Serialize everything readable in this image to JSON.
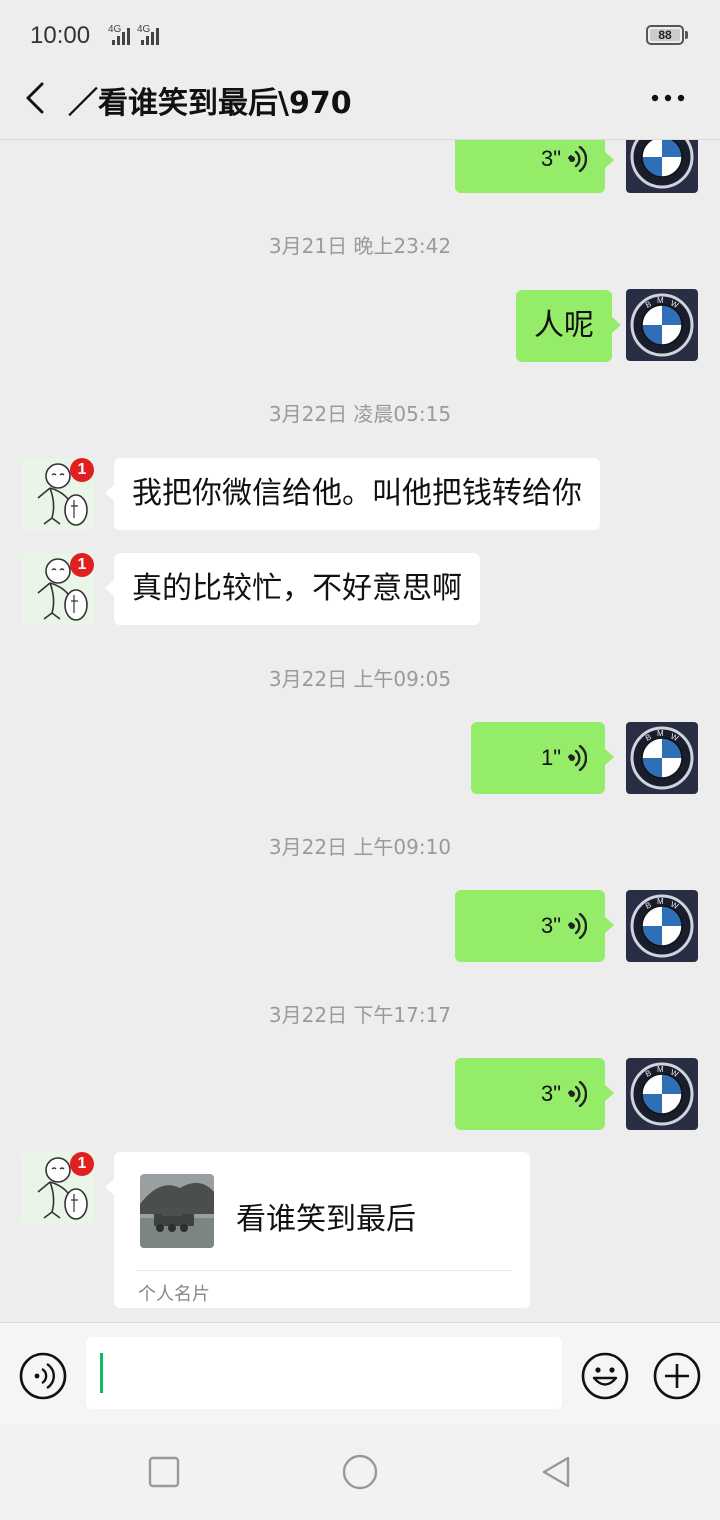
{
  "status": {
    "time": "10:00",
    "net1": "4G",
    "net2": "4G",
    "battery": "88"
  },
  "header": {
    "title": "／看谁笑到最后\\970"
  },
  "contact": {
    "unread_badge": "1"
  },
  "messages": [
    {
      "side": "right",
      "type": "voice",
      "duration": "3\""
    },
    {
      "type": "timestamp",
      "text": "3月21日 晚上23:42"
    },
    {
      "side": "right",
      "type": "text",
      "text": "人呢"
    },
    {
      "type": "timestamp",
      "text": "3月22日 凌晨05:15"
    },
    {
      "side": "left",
      "type": "text",
      "text": "我把你微信给他。叫他把钱转给你"
    },
    {
      "side": "left",
      "type": "text",
      "text": "真的比较忙，不好意思啊"
    },
    {
      "type": "timestamp",
      "text": "3月22日 上午09:05"
    },
    {
      "side": "right",
      "type": "voice",
      "duration": "1\""
    },
    {
      "type": "timestamp",
      "text": "3月22日 上午09:10"
    },
    {
      "side": "right",
      "type": "voice",
      "duration": "3\""
    },
    {
      "type": "timestamp",
      "text": "3月22日 下午17:17"
    },
    {
      "side": "right",
      "type": "voice",
      "duration": "3\""
    },
    {
      "side": "left",
      "type": "card",
      "name": "看谁笑到最后",
      "label": "个人名片"
    }
  ],
  "colors": {
    "bubble_self": "#95ec69",
    "bubble_other": "#ffffff",
    "background": "#ededed",
    "badge": "#e02020",
    "caret": "#07c160"
  },
  "icons": {
    "back": "chevron-left-icon",
    "more": "more-dots-icon",
    "voice": "voice-wave-icon",
    "voice_mode": "voice-mode-icon",
    "emoji": "emoji-icon",
    "plus": "plus-icon"
  }
}
